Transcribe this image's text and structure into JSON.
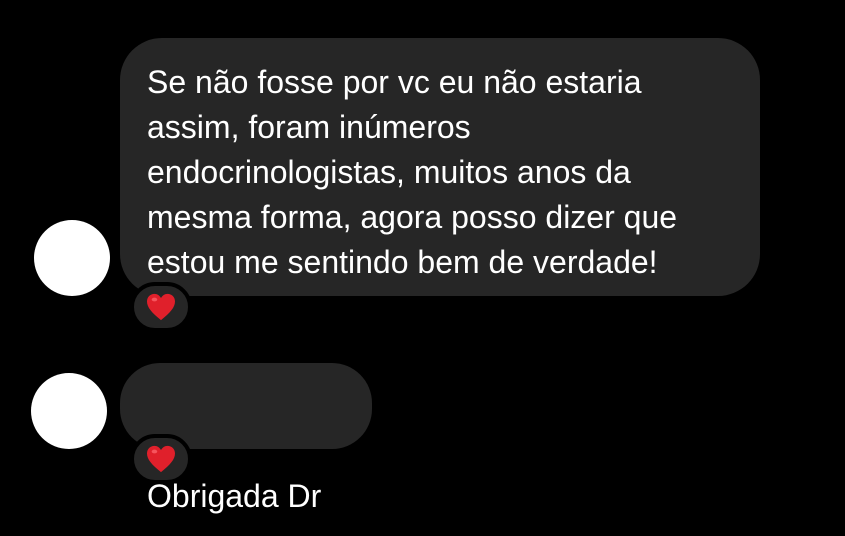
{
  "messages": [
    {
      "lines": [
        "Se não fosse por vc eu não estaria",
        "assim, foram inúmeros",
        "endocrinologistas, muitos anos da",
        "mesma forma, agora posso dizer que",
        "estou me sentindo bem de verdade!"
      ],
      "reaction_icon": "red-heart-icon"
    },
    {
      "text": "Obrigada  Dr",
      "reaction_icon": "red-heart-icon"
    }
  ],
  "colors": {
    "background": "#000000",
    "bubble": "#262626",
    "text": "#ffffff",
    "avatar": "#ffffff",
    "heart": "#e0202b"
  }
}
